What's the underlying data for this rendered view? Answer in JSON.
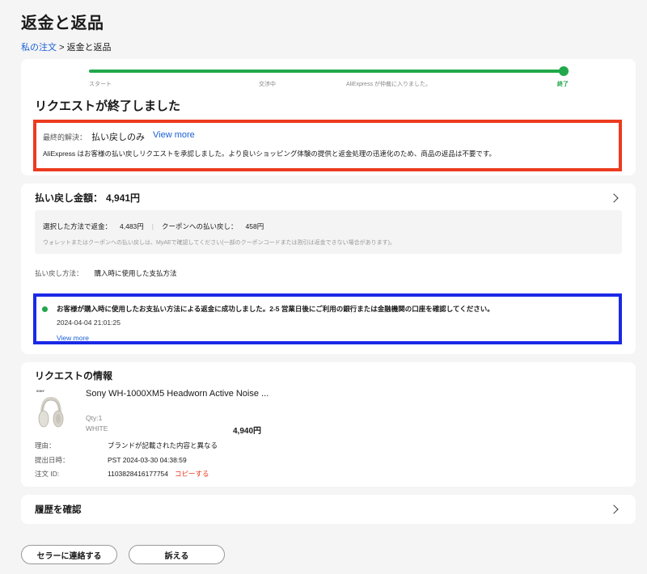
{
  "page": {
    "title": "返金と返品"
  },
  "breadcrumb": {
    "link": "私の注文",
    "separator": ">",
    "current": "返金と返品"
  },
  "progress": {
    "steps": [
      "スタート",
      "交渉中",
      "AliExpress が仲裁に入りました。",
      "終了"
    ],
    "active_step": 3,
    "accent_color": "#21a84a"
  },
  "request_status": {
    "title": "リクエストが終了しました",
    "resolution_label": "最終的解決：",
    "resolution_value": "払い戻しのみ",
    "view_more": "View more",
    "description": "AliExpress はお客様の払い戻しリクエストを承認しました。より良いショッピング体験の提供と返金処理の迅速化のため、商品の返品は不要です。"
  },
  "refund": {
    "title": "払い戻し金額：",
    "amount": "4,941円",
    "method_label": "選択した方法で返金：",
    "method_amount": "4,483円",
    "coupon_label": "クーポンへの払い戻し：",
    "coupon_amount": "458円",
    "note": "ウォレットまたはクーポンへの払い戻しは、MyAEで確認してください(一部のクーポンコードまたは割引は返金できない場合があります)。",
    "payment_label": "払い戻し方法：",
    "payment_value": "購入時に使用した支払方法",
    "status_message": "お客様が購入時に使用したお支払い方法による返金に成功しました。2-5 営業日後にご利用の銀行または金融機関の口座を確認してください。",
    "status_time": "2024-04-04 21:01:25",
    "status_view_more": "View more"
  },
  "request_info": {
    "title": "リクエストの情報",
    "product": {
      "name": "Sony WH-1000XM5 Headworn Active Noise ...",
      "brand_mark": "SONY",
      "qty": "Qty:1",
      "color": "WHITE",
      "price": "4,940円"
    },
    "reason_label": "理由：",
    "reason_value": "ブランドが記載された内容と異なる",
    "date_label": "提出日時：",
    "date_value": "PST 2024-03-30 04:38:59",
    "order_label": "注文 ID:",
    "order_value": "1103828416177754",
    "copy_label": "コピーする"
  },
  "history": {
    "title": "履歴を確認"
  },
  "actions": {
    "contact_seller": "セラーに連絡する",
    "appeal": "訴える"
  },
  "colors": {
    "link": "#1a5fd6",
    "highlight_red": "#ec3b1f",
    "highlight_blue": "#1a29e6",
    "success": "#21a84a"
  }
}
